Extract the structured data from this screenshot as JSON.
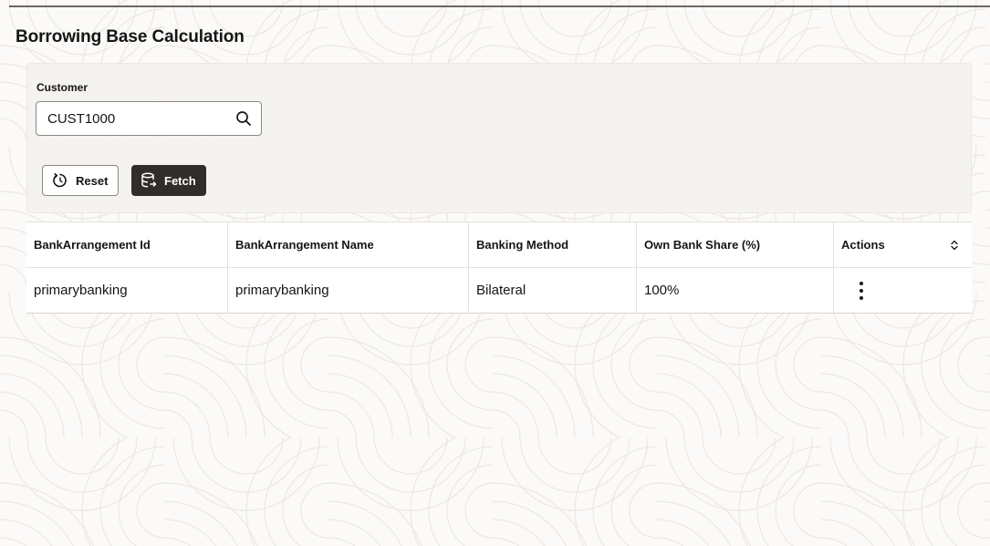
{
  "page": {
    "title": "Borrowing Base Calculation"
  },
  "filter": {
    "customer_label": "Customer",
    "customer_value": "CUST1000",
    "search_icon": "search-icon",
    "reset_label": "Reset",
    "reset_icon": "reset-icon",
    "fetch_label": "Fetch",
    "fetch_icon": "database-fetch-icon"
  },
  "table": {
    "columns": [
      "BankArrangement Id",
      "BankArrangement Name",
      "Banking Method",
      "Own Bank Share (%)",
      "Actions"
    ],
    "rows": [
      {
        "id": "primarybanking",
        "name": "primarybanking",
        "method": "Bilateral",
        "share": "100%",
        "actions_icon": "kebab-menu-icon"
      }
    ],
    "sort_icon": "sort-icon"
  },
  "colors": {
    "primary_button": "#312d2a",
    "panel_background": "#f4f2ef",
    "text": "#161513"
  }
}
